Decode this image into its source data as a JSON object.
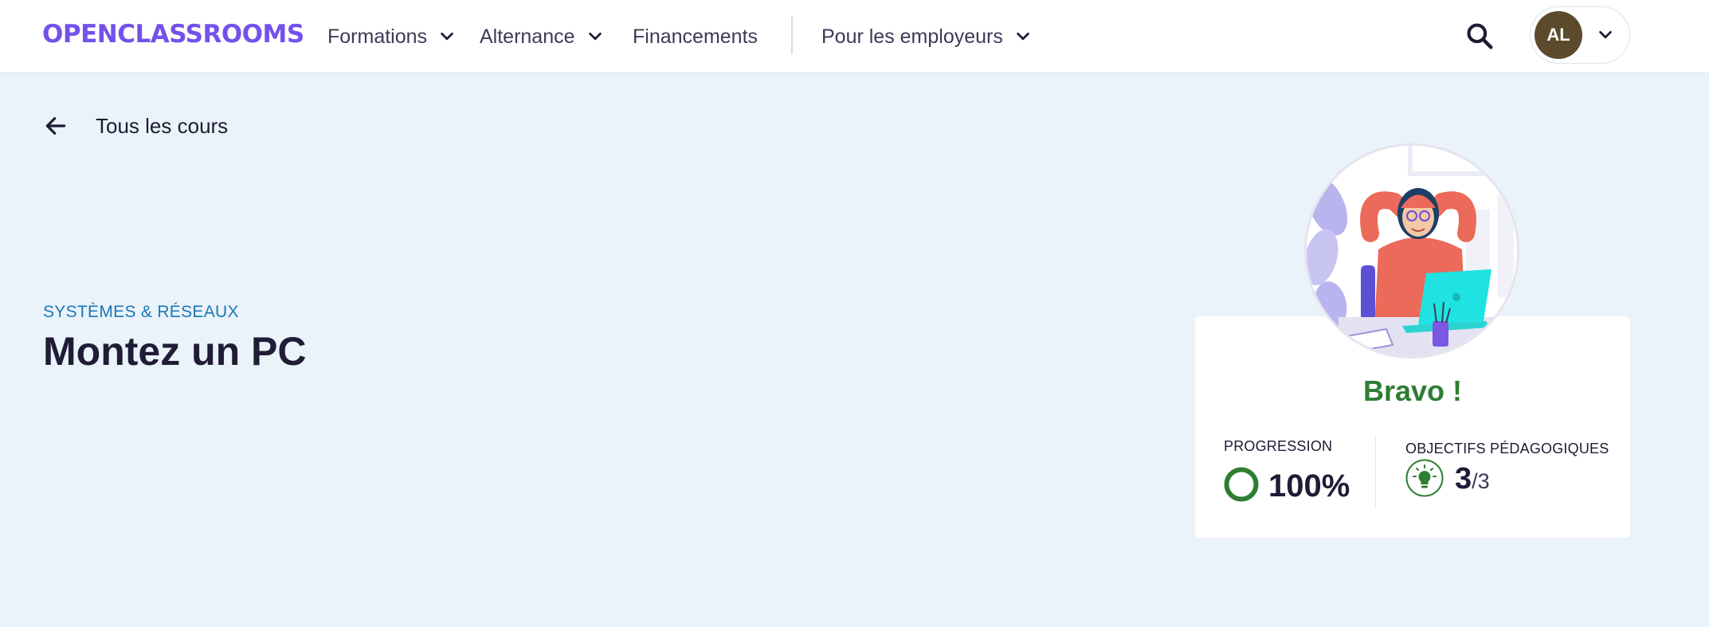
{
  "header": {
    "logo": "OPENCLASSROOMS",
    "nav": [
      {
        "label": "Formations",
        "has_dropdown": true
      },
      {
        "label": "Alternance",
        "has_dropdown": true
      },
      {
        "label": "Financements",
        "has_dropdown": false
      },
      {
        "label": "Pour les employeurs",
        "has_dropdown": true
      }
    ],
    "search_icon": "search-icon",
    "user": {
      "initials": "AL",
      "dropdown_icon": "chevron-down-icon"
    }
  },
  "back_link": {
    "label": "Tous les cours",
    "icon": "arrow-left-icon"
  },
  "course": {
    "category": "SYSTÈMES & RÉSEAUX",
    "title": "Montez un PC"
  },
  "completion_card": {
    "message": "Bravo !",
    "progression": {
      "label": "PROGRESSION",
      "value": "100%",
      "fraction": 1.0
    },
    "objectives": {
      "label": "OBJECTIFS PÉDAGOGIQUES",
      "done": "3",
      "total": "/3"
    }
  },
  "colors": {
    "brand": "#7451eb",
    "page_background": "#eaf2fa",
    "success": "#2e7d32",
    "category": "#1a78b5",
    "avatar": "#5c4a2c"
  }
}
